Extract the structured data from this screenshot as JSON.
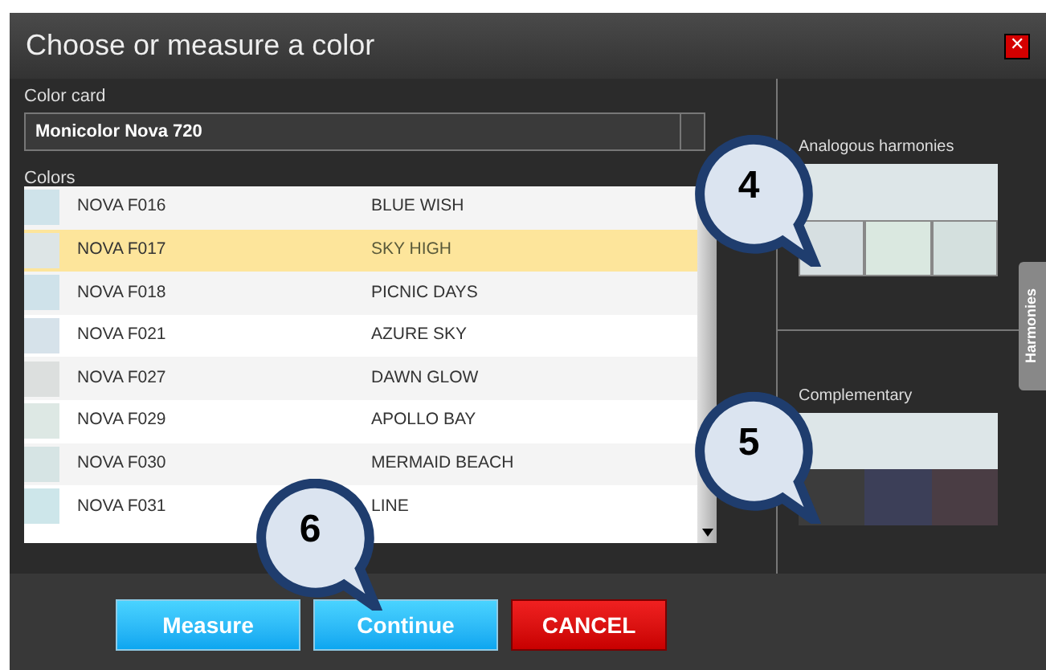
{
  "window": {
    "title": "Choose or measure a color",
    "close": "✕"
  },
  "color_card": {
    "label": "Color card",
    "value": "Monicolor Nova 720"
  },
  "colors": {
    "label": "Colors",
    "rows": [
      {
        "code": "NOVA F016",
        "name": "BLUE WISH",
        "color": "#cfe3ea",
        "selected": false
      },
      {
        "code": "NOVA F017",
        "name": "SKY HIGH",
        "color": "#dde5e6",
        "selected": true
      },
      {
        "code": "NOVA F018",
        "name": "PICNIC DAYS",
        "color": "#cfe2ea",
        "selected": false
      },
      {
        "code": "NOVA F021",
        "name": "AZURE SKY",
        "color": "#d6e2ea",
        "selected": false
      },
      {
        "code": "NOVA F027",
        "name": "DAWN GLOW",
        "color": "#dcdfde",
        "selected": false
      },
      {
        "code": "NOVA F029",
        "name": "APOLLO BAY",
        "color": "#dde8e4",
        "selected": false
      },
      {
        "code": "NOVA F030",
        "name": "MERMAID BEACH",
        "color": "#d6e4e4",
        "selected": false
      },
      {
        "code": "NOVA F031",
        "name": "LINE",
        "color": "#cde6ea",
        "selected": false
      }
    ]
  },
  "analogous": {
    "label": "Analogous harmonies",
    "main": {
      "color": "#dde6e8"
    },
    "swatches": [
      {
        "color": "#d6dfe1"
      },
      {
        "color": "#dae8e0"
      },
      {
        "color": "#d4e0de"
      }
    ]
  },
  "complementary": {
    "label": "Complementary",
    "main": {
      "color": "#dde6e8"
    },
    "swatches": [
      {
        "color": "#3c3c3c"
      },
      {
        "color": "#3c3f58"
      },
      {
        "color": "#4a3d44"
      }
    ]
  },
  "side_tab": {
    "label": "Harmonies"
  },
  "buttons": [
    {
      "label": "Measure",
      "kind": "primary"
    },
    {
      "label": "Continue",
      "kind": "primary"
    },
    {
      "label": "CANCEL",
      "kind": "danger"
    }
  ],
  "callouts": [
    {
      "label": "4"
    },
    {
      "label": "5"
    },
    {
      "label": "6"
    }
  ]
}
